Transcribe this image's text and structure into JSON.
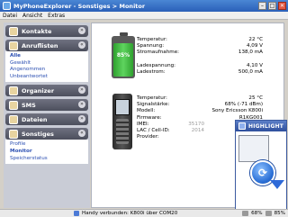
{
  "window": {
    "title": "MyPhoneExplorer  -  Sonstiges > Monitor",
    "min": "–",
    "max": "□",
    "close": "✕"
  },
  "menu": [
    "Datei",
    "Ansicht",
    "Extras"
  ],
  "sidebar": {
    "sections": [
      {
        "label": "Kontakte",
        "chev": "»",
        "items": []
      },
      {
        "label": "Anruflisten",
        "chev": "«",
        "items": [
          "Alle",
          "Gewählt",
          "Angenommen",
          "Unbeantwortet"
        ],
        "active": 0
      },
      {
        "label": "Organizer",
        "chev": "»",
        "items": []
      },
      {
        "label": "SMS",
        "chev": "»",
        "items": []
      },
      {
        "label": "Dateien",
        "chev": "»",
        "items": []
      },
      {
        "label": "Sonstiges",
        "chev": "«",
        "items": [
          "Profile",
          "Monitor",
          "Speicherstatus"
        ],
        "active": 1
      }
    ]
  },
  "battery": {
    "percent_label": "85%",
    "level": 0.85,
    "rows": [
      {
        "label": "Temperatur:",
        "value": "22 °C"
      },
      {
        "label": "Spannung:",
        "value": "4,09 V"
      },
      {
        "label": "Stromaufnahme:",
        "value": "138,0 mA"
      },
      {
        "label": "",
        "value": ""
      },
      {
        "label": "Ladespannung:",
        "value": "4,10 V"
      },
      {
        "label": "Ladestrom:",
        "value": "500,0 mA"
      }
    ]
  },
  "phone": {
    "rows": [
      {
        "label": "Temperatur:",
        "value": "25 °C",
        "gray": false
      },
      {
        "label": "Signalstärke:",
        "value": "68% (-71 dBm)",
        "gray": false
      },
      {
        "label": "Modell:",
        "value": "Sony Ericsson K800i",
        "gray": false
      },
      {
        "label": "Firmware:",
        "value": "R1KG001",
        "gray": false
      },
      {
        "label": "IMEI:",
        "value": "35170",
        "gray": true
      },
      {
        "label": "LAC / Cell-ID:",
        "value": "2014",
        "gray": true
      },
      {
        "label": "Provider:",
        "value": "",
        "gray": false
      }
    ]
  },
  "promo": {
    "title": "HIGHLIGHT"
  },
  "status": {
    "text": "Handy verbunden: K800i über COM20",
    "signal": "68%",
    "battery": "85%"
  }
}
